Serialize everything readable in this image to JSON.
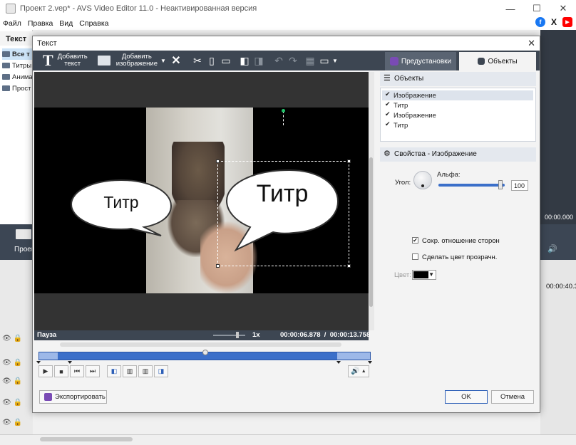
{
  "window": {
    "title": "Проект 2.vep* - AVS Video Editor 11.0 - Неактивированная версия",
    "minimize_glyph": "—",
    "maximize_glyph": "☐",
    "close_glyph": "✕"
  },
  "menu": [
    "Файл",
    "Правка",
    "Вид",
    "Справка"
  ],
  "social": {
    "facebook": "f",
    "x": "X",
    "youtube": "▶"
  },
  "left_panel": {
    "header": "Текст",
    "items": [
      "Все т",
      "Титры",
      "Анима",
      "Прост"
    ],
    "project_label": "Проек"
  },
  "right_bg": {
    "time": "00:00.000",
    "tl_time": "00:00:40.3"
  },
  "dialog": {
    "title": "Текст",
    "close_glyph": "✕",
    "toolbar": {
      "add_text_glyph": "T",
      "add_text": "Добавить\nтекст",
      "add_image": "Добавить\nизображение"
    },
    "tabs": {
      "presets": "Предустановки",
      "objects": "Объекты"
    },
    "bubbles": {
      "left": "Титр",
      "right": "Титр"
    },
    "status": {
      "state": "Пауза",
      "speed": "1x",
      "time": "00:00:06.878  /  00:00:13.758"
    },
    "objects_header": "Объекты",
    "objects": [
      {
        "label": "Изображение",
        "checked": true
      },
      {
        "label": "Титр",
        "checked": true
      },
      {
        "label": "Изображение",
        "checked": true
      },
      {
        "label": "Титр",
        "checked": true
      }
    ],
    "props_header": "Свойства - Изображение",
    "angle_label": "Угол:",
    "alpha_label": "Альфа:",
    "alpha_value": "100",
    "alpha_fraction": 1.0,
    "keep_aspect": {
      "label": "Сохр. отношение сторон",
      "checked": true
    },
    "transparent": {
      "label": "Сделать цвет прозрачн.",
      "checked": false
    },
    "color_label": "Цвет:",
    "color_value": "#000000",
    "playhead_fraction": 0.5,
    "export_label": "Экспортировать",
    "ok_label": "OK",
    "cancel_label": "Отмена"
  }
}
